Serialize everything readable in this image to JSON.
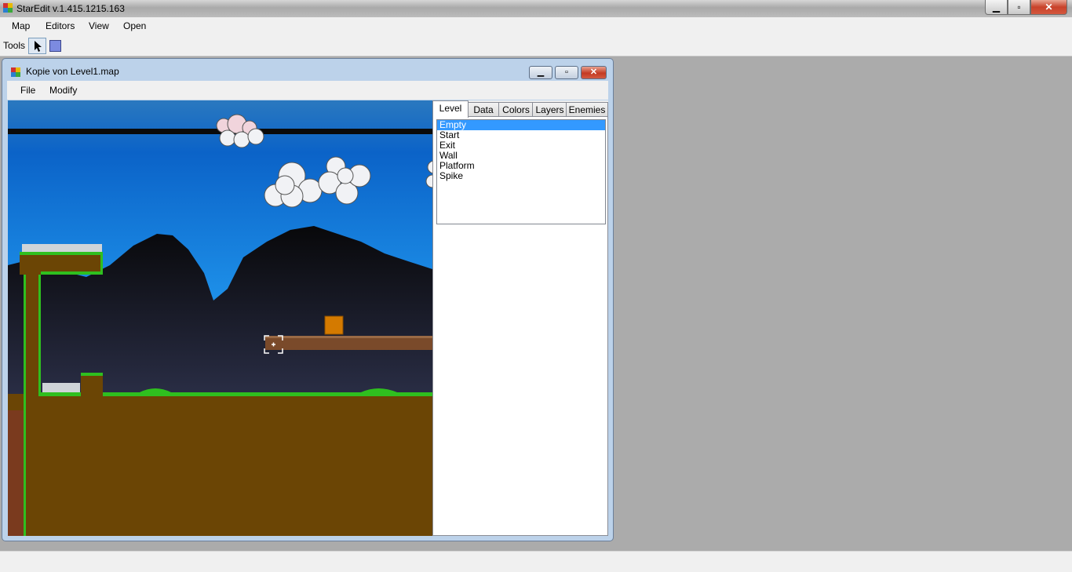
{
  "app": {
    "title": "StarEdit v.1.415.1215.163"
  },
  "caption": {
    "minimize": "▁",
    "maximize": "▫",
    "close": "✕"
  },
  "menubar": {
    "items": [
      "Map",
      "Editors",
      "View",
      "Open"
    ]
  },
  "toolbar": {
    "label": "Tools",
    "tools": [
      "pointer-tool",
      "rectangle-tool"
    ]
  },
  "child_window": {
    "title": "Kopie von Level1.map",
    "menu": [
      "File",
      "Modify"
    ]
  },
  "panel": {
    "tabs": [
      "Level",
      "Data",
      "Colors",
      "Layers",
      "Enemies"
    ],
    "active_tab": "Level",
    "list_items": [
      "Empty",
      "Start",
      "Exit",
      "Wall",
      "Platform",
      "Spike"
    ],
    "selected_item": "Empty"
  },
  "colors": {
    "sky_top": "#0b63c8",
    "ground": "#6b4505",
    "grass": "#2fbf1f",
    "block": "#d47a00",
    "selection": "#3399ff"
  }
}
